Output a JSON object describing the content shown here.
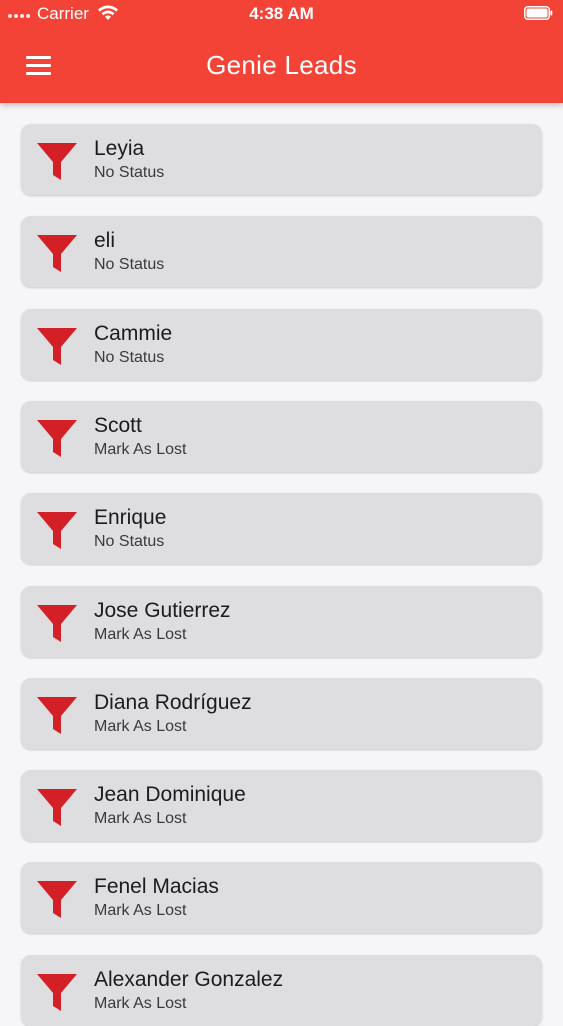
{
  "status_bar": {
    "carrier": "Carrier",
    "time": "4:38 AM"
  },
  "app_bar": {
    "title": "Genie Leads"
  },
  "colors": {
    "primary": "#f34336",
    "funnel": "#d32027",
    "card": "#dedde0",
    "background": "#f6f6f8"
  },
  "leads": [
    {
      "name": "Leyia",
      "status": "No Status"
    },
    {
      "name": "eli",
      "status": "No Status"
    },
    {
      "name": "Cammie",
      "status": "No Status"
    },
    {
      "name": "Scott",
      "status": "Mark As Lost"
    },
    {
      "name": "Enrique",
      "status": "No Status"
    },
    {
      "name": "Jose Gutierrez",
      "status": "Mark As Lost"
    },
    {
      "name": "Diana Rodríguez",
      "status": "Mark As Lost"
    },
    {
      "name": "Jean Dominique",
      "status": "Mark As Lost"
    },
    {
      "name": "Fenel Macias",
      "status": "Mark As Lost"
    },
    {
      "name": "Alexander Gonzalez",
      "status": "Mark As Lost"
    }
  ]
}
